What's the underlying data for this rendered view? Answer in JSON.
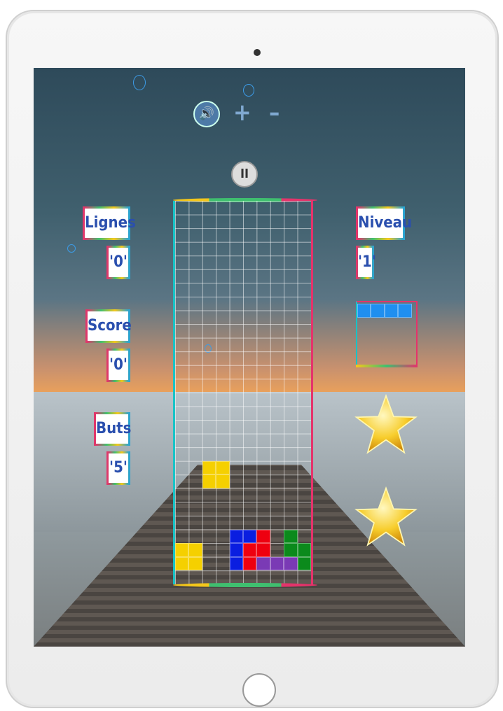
{
  "controls": {
    "sound_icon": "speaker-icon",
    "plus_label": "+",
    "minus_label": "–",
    "pause_label": "II"
  },
  "stats": {
    "lines_label": "Lignes",
    "lines_value": "'0'",
    "score_label": "Score",
    "score_value": "'0'",
    "goals_label": "Buts",
    "goals_value": "'5'",
    "level_label": "Niveau",
    "level_value": "'1'"
  },
  "colors": {
    "yellow": "#f5d000",
    "blue": "#0a1ee0",
    "red": "#ee0010",
    "purple": "#7a3ab5",
    "green": "#0b8a1c",
    "next_blue": "#1f8ff0"
  },
  "board": {
    "columns": 10,
    "rows": 28,
    "blocks": [
      {
        "col": 2,
        "row": 19,
        "color": "yellow"
      },
      {
        "col": 3,
        "row": 19,
        "color": "yellow"
      },
      {
        "col": 2,
        "row": 20,
        "color": "yellow"
      },
      {
        "col": 3,
        "row": 20,
        "color": "yellow"
      },
      {
        "col": 0,
        "row": 25,
        "color": "yellow"
      },
      {
        "col": 1,
        "row": 25,
        "color": "yellow"
      },
      {
        "col": 0,
        "row": 26,
        "color": "yellow"
      },
      {
        "col": 1,
        "row": 26,
        "color": "yellow"
      },
      {
        "col": 4,
        "row": 24,
        "color": "blue"
      },
      {
        "col": 5,
        "row": 24,
        "color": "blue"
      },
      {
        "col": 6,
        "row": 24,
        "color": "red"
      },
      {
        "col": 8,
        "row": 24,
        "color": "green"
      },
      {
        "col": 4,
        "row": 25,
        "color": "blue"
      },
      {
        "col": 5,
        "row": 25,
        "color": "red"
      },
      {
        "col": 6,
        "row": 25,
        "color": "red"
      },
      {
        "col": 8,
        "row": 25,
        "color": "green"
      },
      {
        "col": 9,
        "row": 25,
        "color": "green"
      },
      {
        "col": 4,
        "row": 26,
        "color": "blue"
      },
      {
        "col": 5,
        "row": 26,
        "color": "red"
      },
      {
        "col": 6,
        "row": 26,
        "color": "purple"
      },
      {
        "col": 7,
        "row": 26,
        "color": "purple"
      },
      {
        "col": 8,
        "row": 26,
        "color": "purple"
      },
      {
        "col": 9,
        "row": 26,
        "color": "green"
      }
    ]
  },
  "next_piece": {
    "color": "next_blue",
    "cells": 4
  },
  "stars": 2
}
